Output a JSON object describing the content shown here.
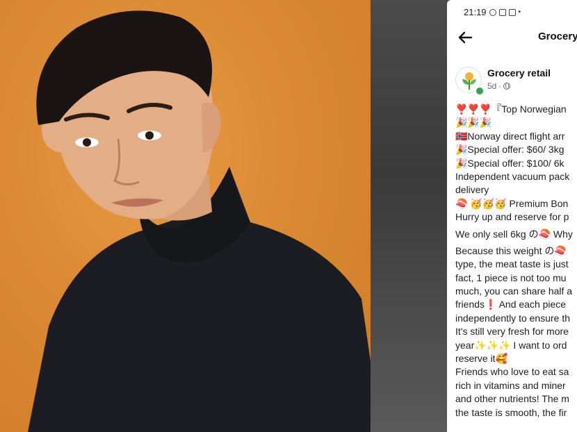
{
  "status_bar": {
    "time": "21:19",
    "icons": [
      "whatsapp-icon",
      "gmail-icon",
      "instagram-icon"
    ],
    "dot": "•"
  },
  "nav": {
    "back_icon": "arrow-left-icon",
    "title": "Grocery"
  },
  "post": {
    "page_name": "Grocery retail",
    "age": "5d",
    "separator": "·",
    "privacy_icon": "globe-icon",
    "avatar_icon": "plant-logo-icon",
    "lines": [
      "❣️❣️❣️『Top Norwegian",
      "🎉🎉🎉",
      "🇳🇴Norway direct flight arr",
      "🎉Special offer: $60/ 3kg",
      "🎉Special offer: $100/ 6k",
      "Independent vacuum pack",
      "delivery",
      "🍣 🥳🥳🥳 Premium Bon",
      "Hurry up and reserve for p",
      "We only sell 6kg の🍣 Why",
      "Because this weight の🍣",
      "type, the meat taste is just",
      "fact, 1 piece is not too mu",
      "much, you can share half a",
      "friends❗ And each piece",
      "independently to ensure th",
      "It's still very fresh for more",
      "year✨✨✨ I want to ord",
      "reserve it🥰",
      "Friends who love to eat sa",
      "rich in vitamins and miner",
      "and other nutrients! The m",
      "the taste is smooth, the fir"
    ]
  },
  "colors": {
    "photo_background": "#db8a33",
    "online_indicator": "#31a24c",
    "meta_text": "#65676b"
  }
}
